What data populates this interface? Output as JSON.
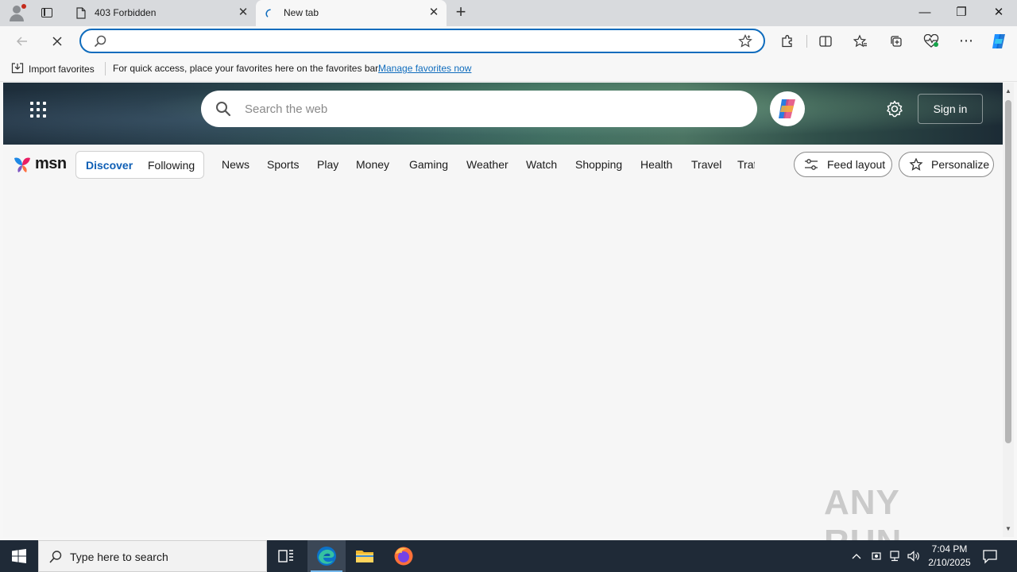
{
  "browser": {
    "tabs": [
      {
        "title": "403 Forbidden",
        "active": false
      },
      {
        "title": "New tab",
        "active": true
      }
    ],
    "new_tab_symbol": "+",
    "window_controls": {
      "minimize": "—",
      "restore": "❐",
      "close": "✕"
    },
    "address": {
      "value": "",
      "placeholder": ""
    },
    "favorites_bar": {
      "import_label": "Import favorites",
      "message": "For quick access, place your favorites here on the favorites bar.",
      "manage_link": "Manage favorites now"
    }
  },
  "msn": {
    "search_placeholder": "Search the web",
    "sign_in": "Sign in",
    "logo_text": "msn",
    "segments": {
      "discover": "Discover",
      "following": "Following"
    },
    "nav": [
      "News",
      "Sports",
      "Play",
      "Money",
      "Gaming",
      "Weather",
      "Watch",
      "Shopping",
      "Health",
      "Travel"
    ],
    "nav_clipped": "Traffic",
    "feed_layout": "Feed layout",
    "personalize": "Personalize"
  },
  "watermark": "ANY RUN",
  "taskbar": {
    "search_placeholder": "Type here to search",
    "time": "7:04 PM",
    "date": "2/10/2025"
  },
  "colors": {
    "accent": "#0f6cbd",
    "taskbar": "#1f2a37",
    "titlebar": "#d8dadd"
  }
}
